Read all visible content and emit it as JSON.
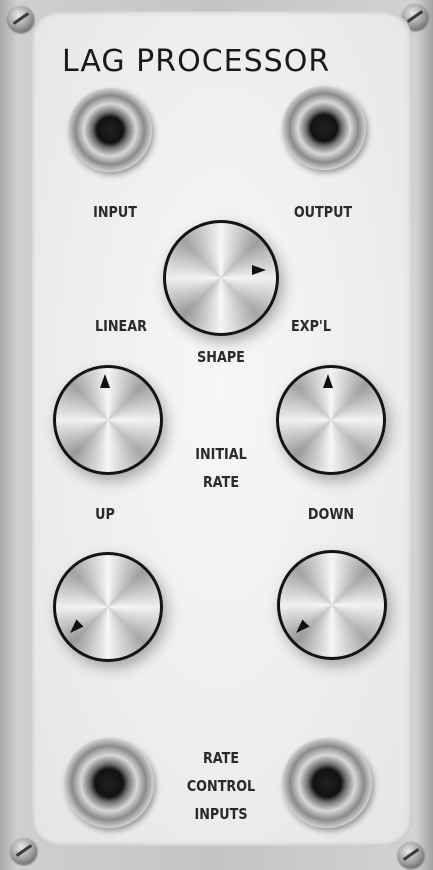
{
  "module": {
    "title": "LAG PROCESSOR",
    "labels": {
      "input": "INPUT",
      "output": "OUTPUT",
      "linear": "LINEAR",
      "expl": "EXP'L",
      "shape": "SHAPE",
      "initial_rate": [
        "INITIAL",
        "RATE"
      ],
      "up": "UP",
      "down": "DOWN",
      "rate_control_inputs": [
        "RATE",
        "CONTROL",
        "INPUTS"
      ]
    }
  }
}
